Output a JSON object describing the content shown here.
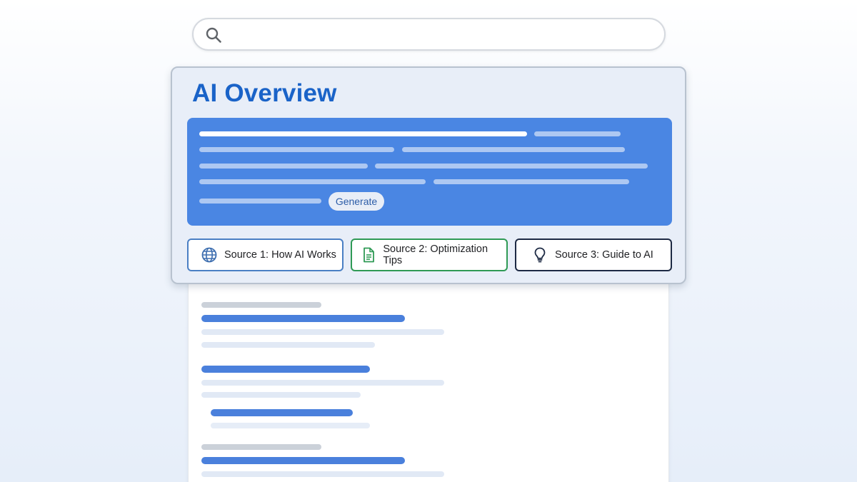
{
  "search": {
    "value": "",
    "placeholder": ""
  },
  "overview": {
    "title": "AI Overview",
    "generate_label": "Generate"
  },
  "sources": [
    {
      "label": "Source 1: How AI Works",
      "icon": "globe-icon",
      "color": "#4a7fc4"
    },
    {
      "label": "Source 2: Optimization Tips",
      "icon": "document-icon",
      "color": "#2f9a55"
    },
    {
      "label": "Source 3: Guide to AI",
      "icon": "lightbulb-icon",
      "color": "#1d2a44"
    }
  ],
  "colors": {
    "accent": "#1a63c8",
    "panel": "#4a86e3",
    "result_link": "#4a80dc"
  }
}
